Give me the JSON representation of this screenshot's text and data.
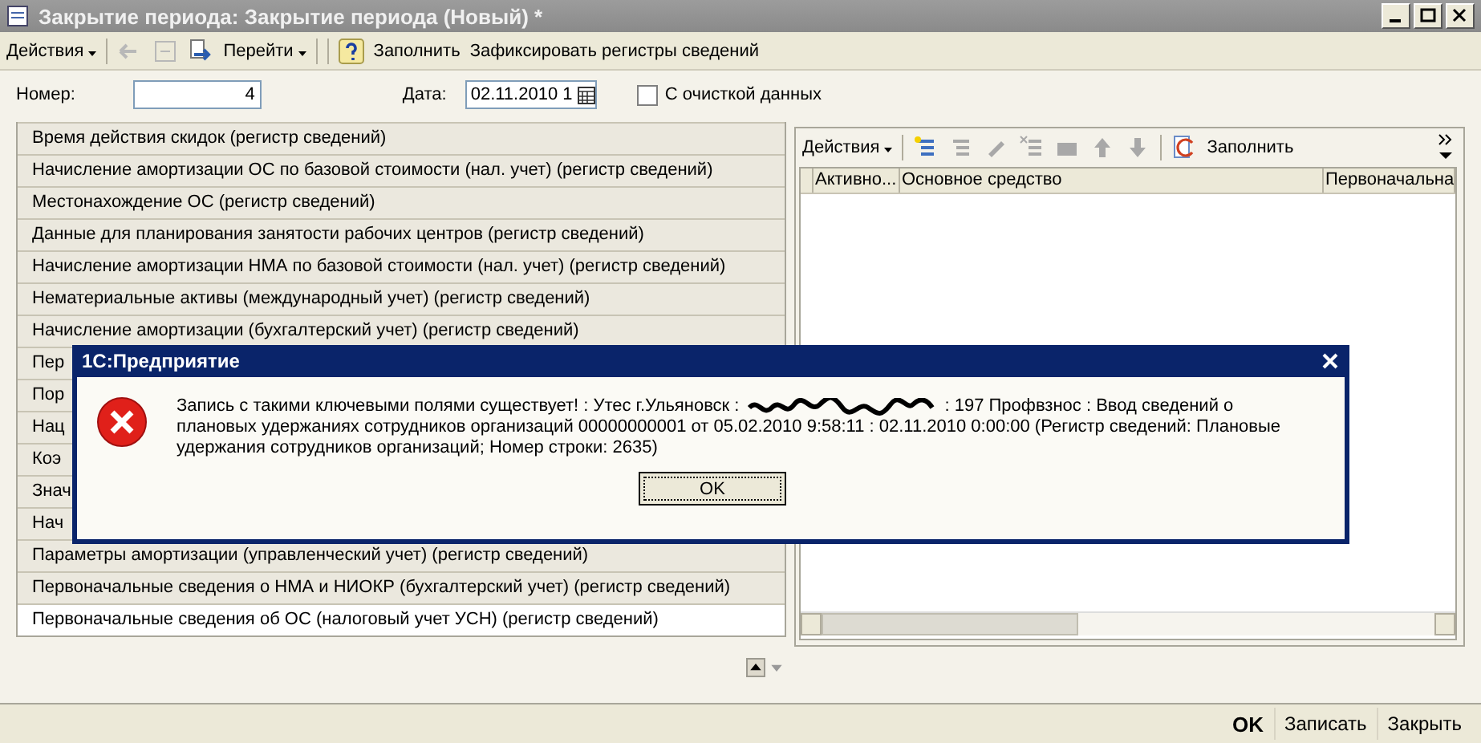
{
  "window": {
    "title": "Закрытие периода: Закрытие периода (Новый) *"
  },
  "toolbar": [
    {
      "kind": "menu",
      "label": "Действия"
    },
    {
      "kind": "icon",
      "disabled": true
    },
    {
      "kind": "icon",
      "disabled": true
    },
    {
      "kind": "icon",
      "disabled": false
    },
    {
      "kind": "menu",
      "label": "Перейти"
    },
    {
      "kind": "help"
    },
    {
      "kind": "text",
      "label": "Заполнить"
    },
    {
      "kind": "text",
      "label": "Зафиксировать регистры сведений"
    }
  ],
  "form": {
    "number_label": "Номер:",
    "number_value": "4",
    "date_label": "Дата:",
    "date_value": "02.11.2010 1",
    "clear_checkbox": {
      "label": "С очисткой данных",
      "checked": false
    }
  },
  "registers": [
    {
      "label": "Время действия скидок (регистр сведений)",
      "selected": false
    },
    {
      "label": "Начисление амортизации ОС по базовой стоимости (нал. учет) (регистр сведений)",
      "selected": false
    },
    {
      "label": "Местонахождение ОС (регистр сведений)",
      "selected": false
    },
    {
      "label": "Данные для планирования занятости рабочих центров (регистр сведений)",
      "selected": false
    },
    {
      "label": "Начисление амортизации НМА по базовой стоимости (нал. учет) (регистр сведений)",
      "selected": false
    },
    {
      "label": "Нематериальные активы (международный учет) (регистр сведений)",
      "selected": false
    },
    {
      "label": "Начисление амортизации (бухгалтерский учет) (регистр сведений)",
      "selected": false
    },
    {
      "label": "Пер",
      "selected": false
    },
    {
      "label": "Пор",
      "selected": false
    },
    {
      "label": "Нац",
      "selected": false
    },
    {
      "label": "Коэ",
      "selected": false
    },
    {
      "label": "Знач",
      "selected": false
    },
    {
      "label": "Нач",
      "selected": false
    },
    {
      "label": "Параметры амортизации (управленческий учет) (регистр сведений)",
      "selected": false
    },
    {
      "label": "Первоначальные сведения о НМА и НИОКР (бухгалтерский учет) (регистр сведений)",
      "selected": false
    },
    {
      "label": "Первоначальные сведения об ОС (налоговый учет УСН) (регистр сведений)",
      "selected": true
    }
  ],
  "right_panel": {
    "toolbar": [
      {
        "kind": "menu",
        "label": "Действия"
      },
      {
        "kind": "icon",
        "disabled": false
      },
      {
        "kind": "icon",
        "disabled": true
      },
      {
        "kind": "icon",
        "disabled": true
      },
      {
        "kind": "icon",
        "disabled": true
      },
      {
        "kind": "icon",
        "disabled": true
      },
      {
        "kind": "icon",
        "disabled": true
      },
      {
        "kind": "icon",
        "disabled": true
      },
      {
        "kind": "text",
        "label": "Заполнить"
      }
    ],
    "table": {
      "columns": [
        "Активно...",
        "Основное средство",
        "Первоначальна"
      ]
    }
  },
  "dialog": {
    "title": "1С:Предприятие",
    "message_start": "Запись с такими ключевыми полями существует! : Утес г.Ульяновск :",
    "message_line_end": ": 197 Профвзнос : Ввод сведений о",
    "message_rest": "плановых удержаниях сотрудников организаций 00000000001 от 05.02.2010 9:58:11 : 02.11.2010 0:00:00 (Регистр сведений: Плановые удержания сотрудников организаций; Номер строки: 2635)",
    "button": "OK"
  },
  "footer": [
    {
      "label": "OK",
      "kind": "default"
    },
    {
      "label": "Записать",
      "kind": "normal"
    },
    {
      "label": "Закрыть",
      "kind": "normal"
    }
  ]
}
